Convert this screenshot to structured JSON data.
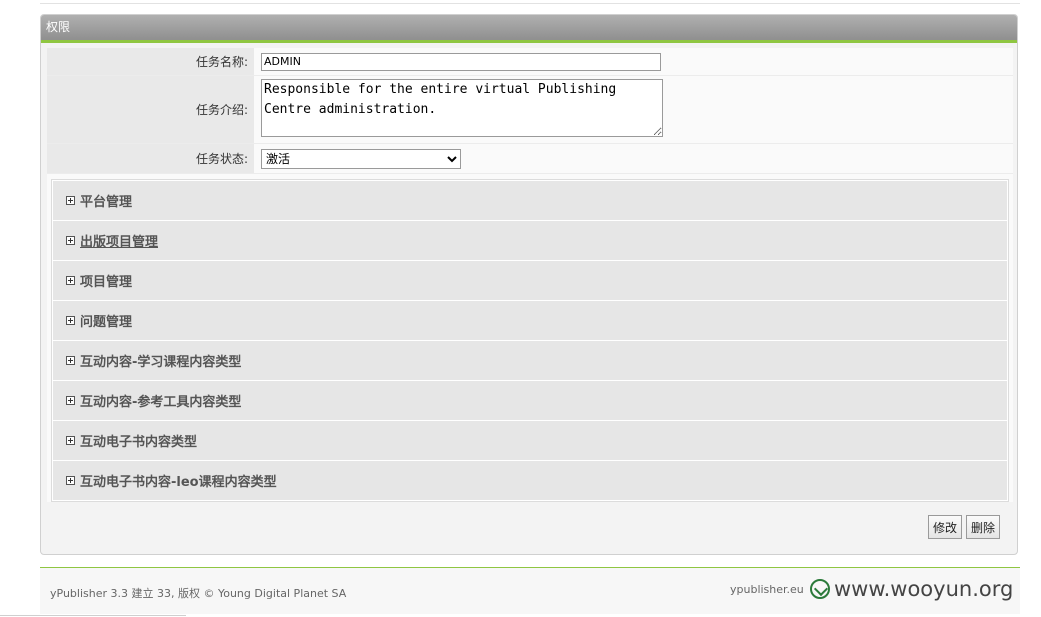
{
  "panel": {
    "title": "权限"
  },
  "form": {
    "name_label": "任务名称:",
    "name_value": "ADMIN",
    "desc_label": "任务介绍:",
    "desc_value": "Responsible for the entire virtual Publishing Centre administration.",
    "status_label": "任务状态:",
    "status_value": "激活",
    "status_options": [
      "激活"
    ]
  },
  "permissions": [
    {
      "label": "平台管理"
    },
    {
      "label": "出版项目管理"
    },
    {
      "label": "项目管理"
    },
    {
      "label": "问题管理"
    },
    {
      "label": "互动内容-学习课程内容类型"
    },
    {
      "label": "互动内容-参考工具内容类型"
    },
    {
      "label": "互动电子书内容类型"
    },
    {
      "label": "互动电子书内容-leo课程内容类型"
    }
  ],
  "actions": {
    "edit_label": "修改",
    "delete_label": "删除"
  },
  "footer": {
    "left_text": "yPublisher 3.3 建立 33, 版权 © Young Digital Planet SA",
    "right_text": "ypublisher.eu"
  },
  "watermark": {
    "text": "www.wooyun.org"
  }
}
